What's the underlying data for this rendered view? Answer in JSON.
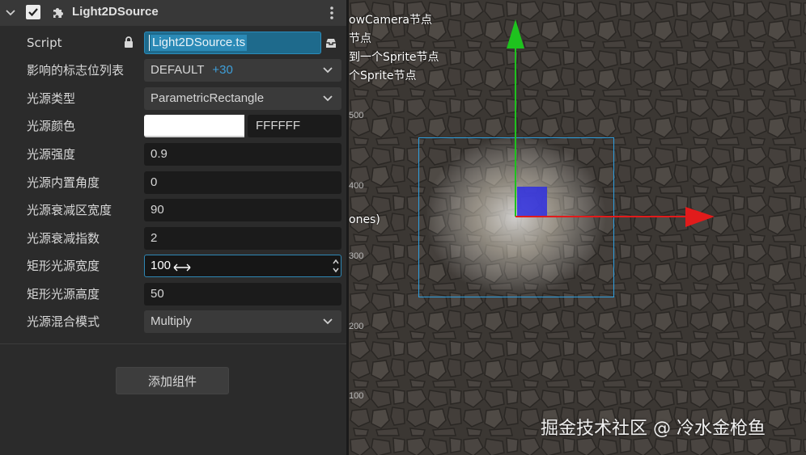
{
  "component": {
    "title": "Light2DSource",
    "enabled": true
  },
  "properties": {
    "script": {
      "label": "Script",
      "value": "Light2DSource.ts"
    },
    "flags": {
      "label": "影响的标志位列表",
      "value": "DEFAULT",
      "extra": "+30"
    },
    "light_type": {
      "label": "光源类型",
      "value": "ParametricRectangle"
    },
    "light_color": {
      "label": "光源颜色",
      "swatch": "#FFFFFF",
      "hex": "FFFFFF"
    },
    "intensity": {
      "label": "光源强度",
      "value": "0.9"
    },
    "inner_angle": {
      "label": "光源内置角度",
      "value": "0"
    },
    "falloff_width": {
      "label": "光源衰减区宽度",
      "value": "90"
    },
    "falloff_exponent": {
      "label": "光源衰减指数",
      "value": "2"
    },
    "rect_width": {
      "label": "矩形光源宽度",
      "value": "100"
    },
    "rect_height": {
      "label": "矩形光源高度",
      "value": "50"
    },
    "blend_mode": {
      "label": "光源混合模式",
      "value": "Multiply"
    }
  },
  "add_component": {
    "label": "添加组件"
  },
  "scene": {
    "overlay_lines": [
      "owCamera节点",
      "节点",
      "到一个Sprite节点",
      "个Sprite节点",
      "ones)"
    ],
    "ruler_ticks": [
      "500",
      "400",
      "300",
      "200",
      "100"
    ],
    "watermark": "掘金技术社区 @ 冷水金枪鱼"
  },
  "colors": {
    "accent": "#2a8cbb",
    "gizmo_x": "#e21b1b",
    "gizmo_y": "#1ec21e",
    "gizmo_center": "#2e2ee0",
    "selection": "#2e9fe0"
  }
}
